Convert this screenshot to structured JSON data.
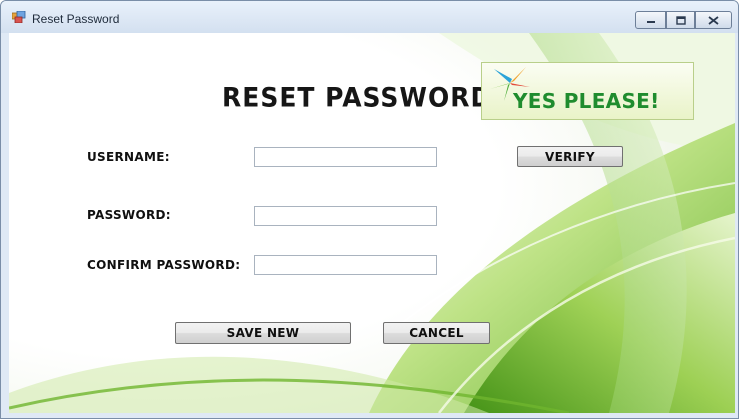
{
  "window": {
    "title": "Reset Password",
    "controls": {
      "minimize": "minimize",
      "maximize": "maximize",
      "close": "close"
    }
  },
  "form": {
    "heading": "RESET PASSWORD",
    "logo_text": "YES PLEASE!",
    "username_label": "USERNAME:",
    "password_label": "PASSWORD:",
    "confirm_password_label": "CONFIRM PASSWORD:",
    "username_value": "",
    "password_value": "",
    "confirm_password_value": "",
    "verify_button": "VERIFY",
    "save_button": "SAVE NEW",
    "cancel_button": "CANCEL"
  },
  "colors": {
    "accent_green": "#7cc242",
    "logo_text": "#1f8c2e",
    "titlebar": "#dfe9f5"
  }
}
